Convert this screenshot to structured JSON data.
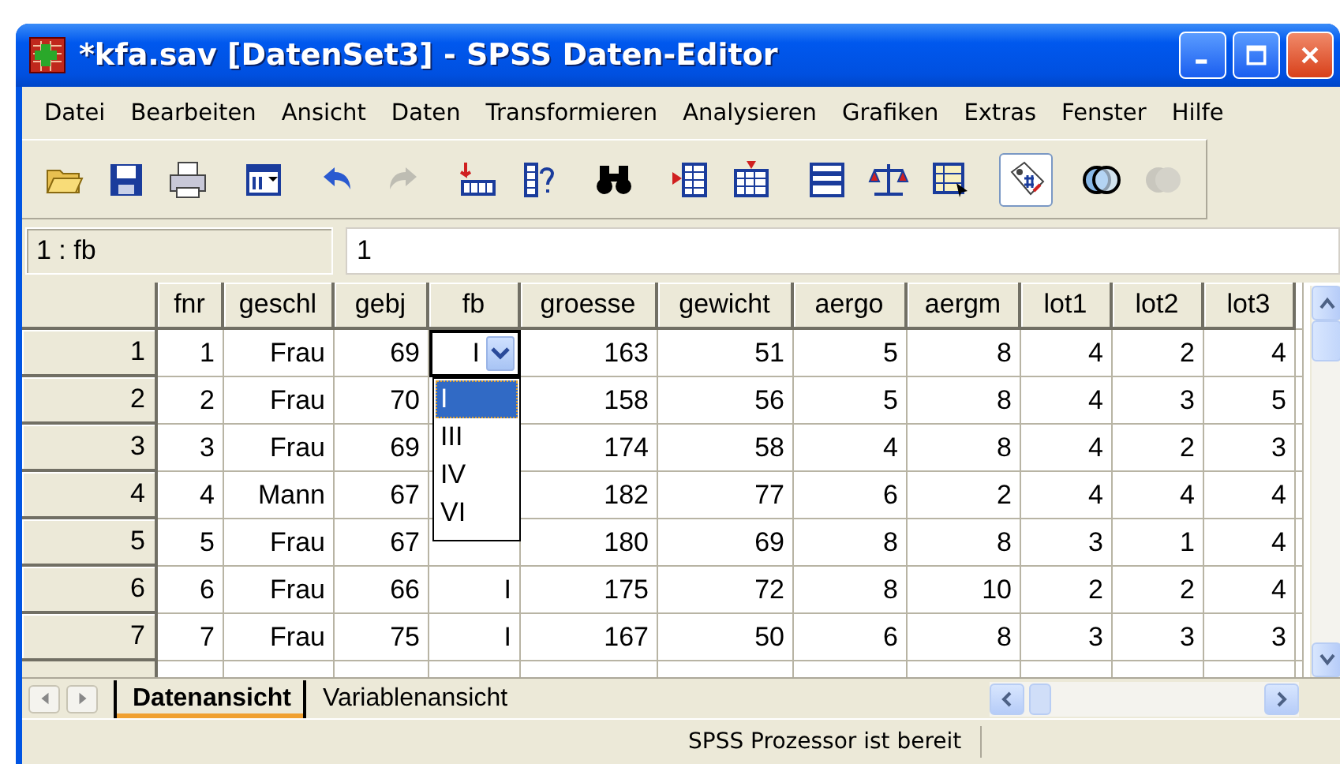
{
  "window": {
    "title": "*kfa.sav [DatenSet3] - SPSS Daten-Editor"
  },
  "menu": [
    "Datei",
    "Bearbeiten",
    "Ansicht",
    "Daten",
    "Transformieren",
    "Analysieren",
    "Grafiken",
    "Extras",
    "Fenster",
    "Hilfe"
  ],
  "toolbar": [
    [
      {
        "kind": "open",
        "pressed": false,
        "disabled": false
      },
      {
        "kind": "save",
        "pressed": false,
        "disabled": false
      },
      {
        "kind": "print",
        "pressed": false,
        "disabled": false
      }
    ],
    [
      {
        "kind": "dialog",
        "pressed": false,
        "disabled": false
      }
    ],
    [
      {
        "kind": "undo",
        "pressed": false,
        "disabled": false
      },
      {
        "kind": "redo",
        "pressed": false,
        "disabled": true
      }
    ],
    [
      {
        "kind": "goto",
        "pressed": false,
        "disabled": false
      },
      {
        "kind": "variables",
        "pressed": false,
        "disabled": false
      }
    ],
    [
      {
        "kind": "find",
        "pressed": false,
        "disabled": false
      }
    ],
    [
      {
        "kind": "insertcase",
        "pressed": false,
        "disabled": false
      },
      {
        "kind": "insertvar",
        "pressed": false,
        "disabled": false
      }
    ],
    [
      {
        "kind": "split",
        "pressed": false,
        "disabled": false
      },
      {
        "kind": "weight",
        "pressed": false,
        "disabled": false
      },
      {
        "kind": "select",
        "pressed": false,
        "disabled": false
      }
    ],
    [
      {
        "kind": "labels",
        "pressed": true,
        "disabled": false
      }
    ],
    [
      {
        "kind": "sets",
        "pressed": false,
        "disabled": false
      },
      {
        "kind": "showall",
        "pressed": false,
        "disabled": true
      }
    ]
  ],
  "cell_ref": {
    "name": "1 : fb",
    "value": "1"
  },
  "table": {
    "columns": [
      "fnr",
      "geschl",
      "gebj",
      "fb",
      "groesse",
      "gewicht",
      "aergo",
      "aergm",
      "lot1",
      "lot2",
      "lot3"
    ],
    "rows": [
      {
        "label": "1",
        "cells": [
          "1",
          "Frau",
          "69",
          {
            "kind": "combo",
            "value": "I",
            "options": [
              {
                "label": "I",
                "selected": true
              },
              {
                "label": "III",
                "selected": false
              },
              {
                "label": "IV",
                "selected": false
              },
              {
                "label": "VI",
                "selected": false
              }
            ]
          },
          "163",
          "51",
          "5",
          "8",
          "4",
          "2",
          "4"
        ]
      },
      {
        "label": "2",
        "cells": [
          "2",
          "Frau",
          "70",
          null,
          "158",
          "56",
          "5",
          "8",
          "4",
          "3",
          "5"
        ]
      },
      {
        "label": "3",
        "cells": [
          "3",
          "Frau",
          "69",
          null,
          "174",
          "58",
          "4",
          "8",
          "4",
          "2",
          "3"
        ]
      },
      {
        "label": "4",
        "cells": [
          "4",
          "Mann",
          "67",
          null,
          "182",
          "77",
          "6",
          "2",
          "4",
          "4",
          "4"
        ]
      },
      {
        "label": "5",
        "cells": [
          "5",
          "Frau",
          "67",
          null,
          "180",
          "69",
          "8",
          "8",
          "3",
          "1",
          "4"
        ]
      },
      {
        "label": "6",
        "cells": [
          "6",
          "Frau",
          "66",
          "I",
          "175",
          "72",
          "8",
          "10",
          "2",
          "2",
          "4"
        ]
      },
      {
        "label": "7",
        "cells": [
          "7",
          "Frau",
          "75",
          "I",
          "167",
          "50",
          "6",
          "8",
          "3",
          "3",
          "3"
        ]
      }
    ]
  },
  "tabs": [
    {
      "label": "Datenansicht",
      "selected": true
    },
    {
      "label": "Variablenansicht",
      "selected": false
    }
  ],
  "status_bar": "SPSS Prozessor ist bereit"
}
